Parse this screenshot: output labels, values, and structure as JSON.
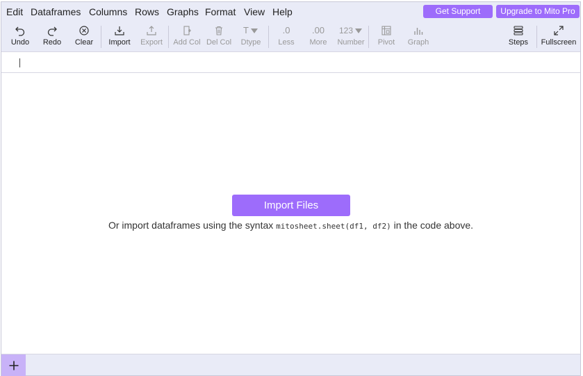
{
  "menu": [
    "Edit",
    "Dataframes",
    "Columns",
    "Rows",
    "Graphs",
    "Format",
    "View",
    "Help"
  ],
  "top_buttons": {
    "support": "Get Support",
    "upgrade": "Upgrade to Mito Pro"
  },
  "toolbar": {
    "undo": "Undo",
    "redo": "Redo",
    "clear": "Clear",
    "import": "Import",
    "export": "Export",
    "add_col": "Add Col",
    "del_col": "Del Col",
    "dtype": "Dtype",
    "dtype_icon": "T",
    "less": "Less",
    "less_icon": ".0",
    "more": "More",
    "more_icon": ".00",
    "number": "Number",
    "number_icon": "123",
    "pivot": "Pivot",
    "graph": "Graph",
    "steps": "Steps",
    "fullscreen": "Fullscreen"
  },
  "empty_state": {
    "import_button": "Import Files",
    "hint_prefix": "Or import dataframes using the syntax ",
    "hint_code": "mitosheet.sheet(df1, df2)",
    "hint_suffix": " in the code above."
  },
  "colors": {
    "accent": "#9d6cfb",
    "bar_bg": "#e9ebf7",
    "add_tab_bg": "#c8b2f8"
  }
}
